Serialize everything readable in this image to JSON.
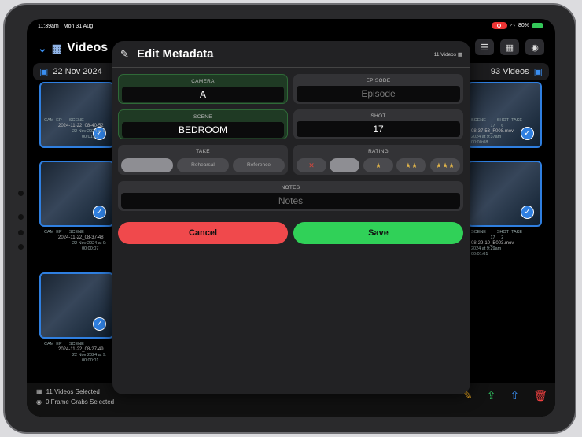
{
  "status": {
    "time": "11:39am",
    "date": "Mon 31 Aug",
    "battery": "80%"
  },
  "nav": {
    "title": "Videos"
  },
  "datebar": {
    "date": "22 Nov 2024",
    "count": "93 Videos"
  },
  "cells": [
    {
      "file": "2024-11-22_08-40-52",
      "date": "22 Nov 2024 at 9:",
      "dur": "00:01:23"
    },
    {
      "file": "2024-11-22_08-37-48",
      "date": "22 Nov 2024 at 9:",
      "dur": "00:00:07"
    },
    {
      "file": "2024-11-22_08-27-49",
      "date": "22 Nov 2024 at 9:",
      "dur": "00:00:01"
    }
  ],
  "right_cells": [
    {
      "file": "08-37-53_F008.mov",
      "date": "2024 at 9:37am",
      "dur": "00:00:08",
      "shot": "17",
      "take": "6"
    },
    {
      "file": "08-29-10_B003.mov",
      "date": "2024 at 9:29am",
      "dur": "00:01:01",
      "shot": "17",
      "take": "2"
    }
  ],
  "meta_labels": {
    "cam": "CAM",
    "ep": "EP",
    "scene": "SCENE",
    "shot": "SHOT",
    "take": "TAKE"
  },
  "bottom": {
    "videos_selected": "11 Videos Selected",
    "frames_selected": "0 Frame Grabs Selected"
  },
  "modal": {
    "title": "Edit Metadata",
    "count": "11 Videos",
    "camera": {
      "label": "CAMERA",
      "value": "A"
    },
    "episode": {
      "label": "EPISODE",
      "placeholder": "Episode"
    },
    "scene": {
      "label": "SCENE",
      "value": "BEDROOM"
    },
    "shot": {
      "label": "SHOT",
      "value": "17"
    },
    "take": {
      "label": "TAKE",
      "options": [
        "-",
        "Rehearsal",
        "Reference"
      ],
      "selected": "-"
    },
    "rating": {
      "label": "RATING",
      "options": [
        "✕",
        "-",
        "★",
        "★★",
        "★★★"
      ],
      "selected": "-"
    },
    "notes": {
      "label": "NOTES",
      "placeholder": "Notes"
    },
    "cancel": "Cancel",
    "save": "Save"
  }
}
